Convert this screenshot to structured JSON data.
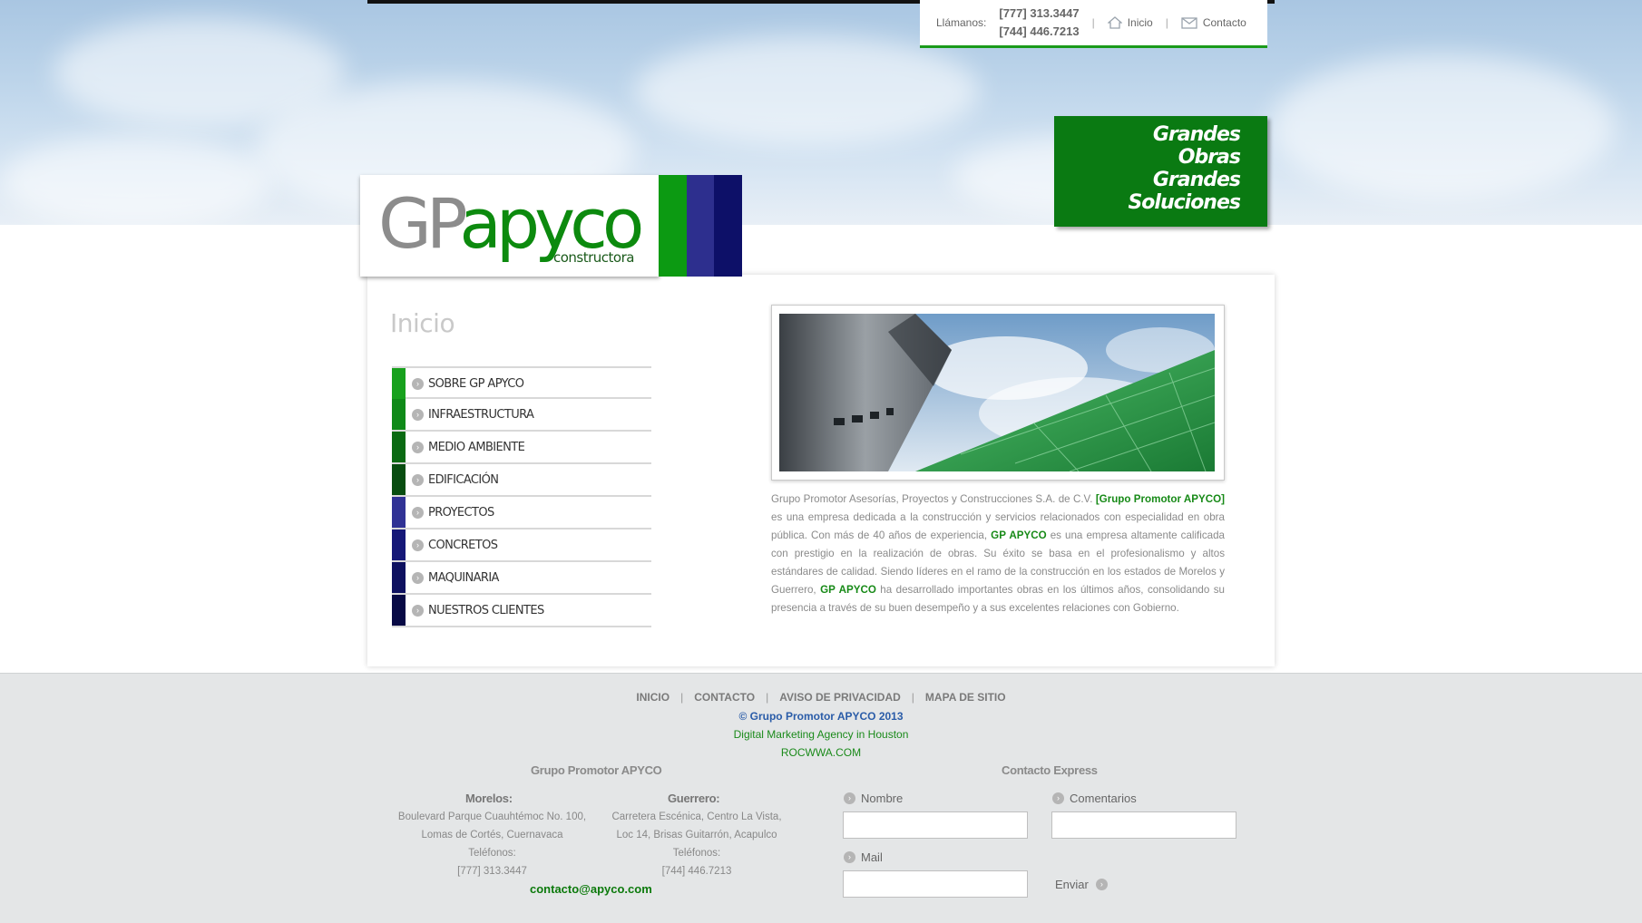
{
  "header": {
    "call_label": "Llámanos:",
    "phone1": "[777] 313.3447",
    "phone2": "[744] 446.7213",
    "nav_home": "Inicio",
    "nav_contact": "Contacto"
  },
  "slogan": [
    "Grandes",
    "Obras",
    "Grandes",
    "Soluciones"
  ],
  "logo": {
    "gp": "GP",
    "apyco": "apyco",
    "sub": "constructora",
    "stripe_colors": [
      "#0c9a12",
      "#2d2f8e",
      "#0d1068"
    ]
  },
  "page": {
    "title": "Inicio"
  },
  "menu": [
    {
      "label": "SOBRE GP APYCO",
      "color": "#17a11d"
    },
    {
      "label": "INFRAESTRUCTURA",
      "color": "#0f8a18"
    },
    {
      "label": "MEDIO AMBIENTE",
      "color": "#0a6a12"
    },
    {
      "label": "EDIFICACIÓN",
      "color": "#084d10"
    },
    {
      "label": "PROYECTOS",
      "color": "#303295"
    },
    {
      "label": "CONCRETOS",
      "color": "#151878"
    },
    {
      "label": "MAQUINARIA",
      "color": "#0e1160"
    },
    {
      "label": "NUESTROS CLIENTES",
      "color": "#080a45"
    }
  ],
  "description": {
    "p1": "Grupo Promotor Asesorías, Proyectos y Construcciones S.A. de C.V. ",
    "h1": "[Grupo Promotor APYCO]",
    "p2": " es una empresa dedicada a la construcción y servicios relacionados con especialidad en obra pública. Con más de 40 años de experiencia, ",
    "h2": "GP APYCO",
    "p3": " es una empresa altamente calificada con prestigio en la realización de obras. Su éxito se basa en el profesionalismo y altos estándares de calidad. Siendo líderes en el ramo de la construcción en los estados de Morelos y Guerrero, ",
    "h3": "GP APYCO",
    "p4": " ha desarrollado importantes obras en los últimos años, consolidando su presencia a través de su buen desempeño y a sus excelentes relaciones con Gobierno."
  },
  "footer": {
    "links": [
      "INICIO",
      "CONTACTO",
      "AVISO DE PRIVACIDAD",
      "MAPA DE SITIO"
    ],
    "copyright": "© Grupo Promotor APYCO 2013",
    "agency": "Digital Marketing Agency in Houston",
    "agency_site": "ROCWWA.COM",
    "company_title": "Grupo Promotor APYCO",
    "morelos": {
      "city": "Morelos:",
      "line1": "Boulevard Parque Cuauhtémoc No. 100,",
      "line2": "Lomas de Cortés, Cuernavaca",
      "phones_label": "Teléfonos:",
      "phone": "[777] 313.3447"
    },
    "guerrero": {
      "city": "Guerrero:",
      "line1": "Carretera Escénica, Centro La Vista,",
      "line2": "Loc 14, Brisas Guitarrón, Acapulco",
      "phones_label": "Teléfonos:",
      "phone": "[744] 446.7213"
    },
    "email": "contacto@apyco.com",
    "contact_title": "Contacto Express",
    "form": {
      "name_label": "Nombre",
      "comments_label": "Comentarios",
      "mail_label": "Mail",
      "send_label": "Enviar"
    }
  }
}
